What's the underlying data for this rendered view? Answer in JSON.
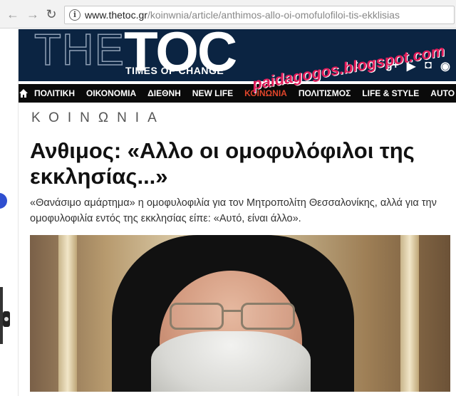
{
  "browser": {
    "back_icon": "arrow-left-icon",
    "forward_icon": "arrow-right-icon",
    "reload_icon": "reload-icon",
    "url_host": "www.thetoc.gr",
    "url_path": "/koinwnia/article/anthimos-allo-oi-omofulofiloi-tis-ekklisias"
  },
  "site": {
    "logo_the": "THE",
    "logo_toc": "TOC",
    "tagline": "TIMES OF CHANGE",
    "brand_color": "#0b2442",
    "social": [
      "twitter-icon",
      "facebook-icon",
      "googleplus-icon",
      "youtube-icon",
      "instagram-icon",
      "rss-icon"
    ],
    "social_glyphs": [
      "t",
      "f",
      "g+",
      "▶",
      "◘",
      "◉"
    ]
  },
  "nav": {
    "active_color": "#e0452a",
    "items": [
      "ΠΟΛΙΤΙΚΗ",
      "ΟΙΚΟΝΟΜΙΑ",
      "ΔΙΕΘΝΗ",
      "NEW LIFE",
      "ΚΟΙΝΩΝΙΑ",
      "ΠΟΛΙΤΙΣΜΟΣ",
      "LIFE & STYLE",
      "AUTO"
    ],
    "active_index": 4
  },
  "watermark": "paidagogos.blogspot.com",
  "article": {
    "section": "ΚΟΙΝΩΝΙΑ",
    "headline": "Ανθιμος: «Αλλο οι ομοφυλόφιλοι της εκκλησίας...»",
    "lede": "«Θανάσιμο αμάρτημα» η ομοφυλοφιλία για τον Μητροπολίτη Θεσσαλονίκης, αλλά για την ομοφυλοφιλία εντός της εκκλησίας είπε: «Αυτό, είναι άλλο»."
  }
}
